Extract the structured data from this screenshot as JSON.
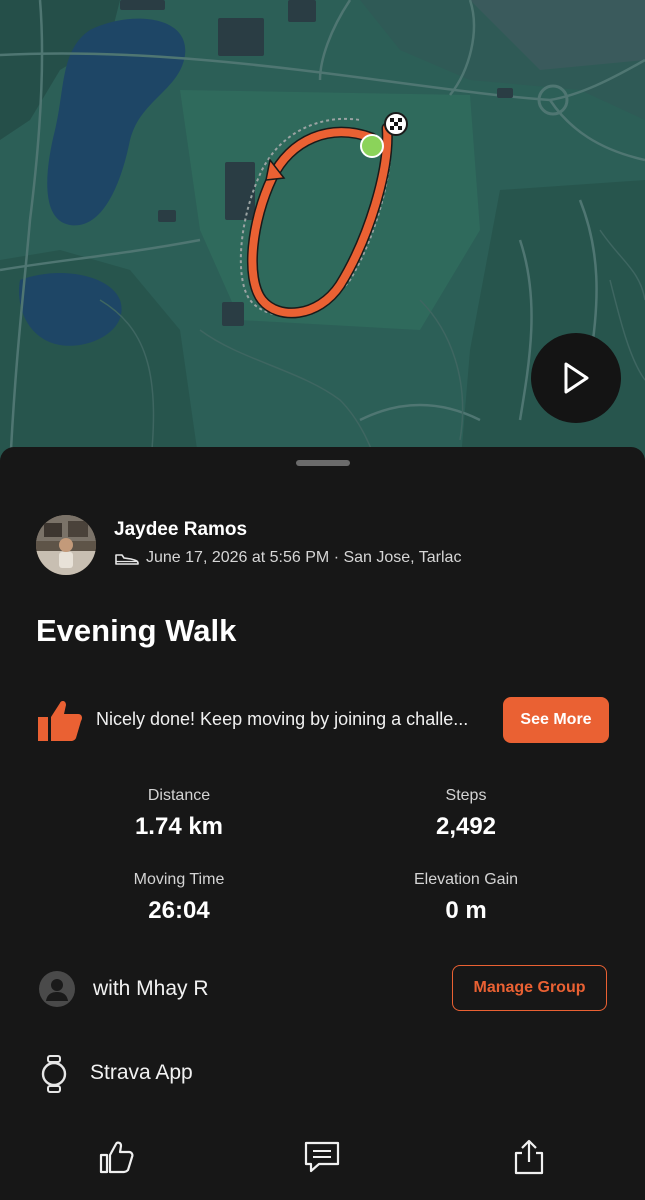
{
  "map": {
    "route_color": "#ea6133",
    "start_marker_color": "#8bd35a",
    "play_icon": "play-icon"
  },
  "activity": {
    "athlete_name": "Jaydee Ramos",
    "meta": "June 17, 2026 at 5:56 PM · San Jose, Tarlac",
    "sport_icon": "shoe-icon",
    "title": "Evening Walk"
  },
  "promo": {
    "icon": "thumbs-up-icon",
    "text": "Nicely done! Keep moving by joining a challe...",
    "button_label": "See More"
  },
  "stats": [
    {
      "label": "Distance",
      "value": "1.74 km"
    },
    {
      "label": "Steps",
      "value": "2,492"
    },
    {
      "label": "Moving Time",
      "value": "26:04"
    },
    {
      "label": "Elevation Gain",
      "value": "0 m"
    }
  ],
  "group": {
    "text": "with Mhay R",
    "button_label": "Manage Group"
  },
  "device": {
    "icon": "watch-icon",
    "text": "Strava App"
  },
  "actions": [
    "kudos-icon",
    "comment-icon",
    "share-icon"
  ],
  "colors": {
    "accent": "#ea6133",
    "background": "#171717",
    "map_base": "#2c5f57"
  }
}
